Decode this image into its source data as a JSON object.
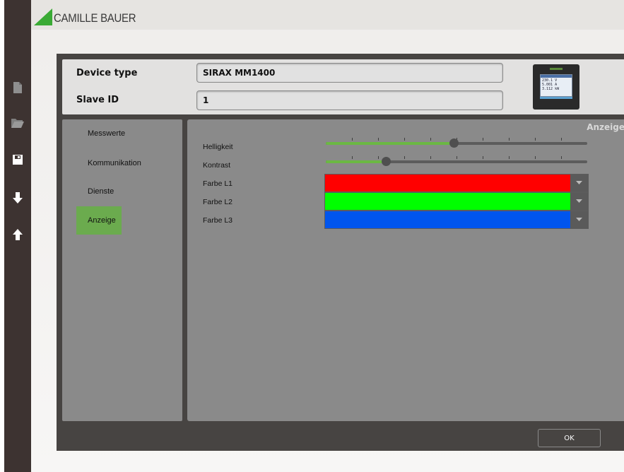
{
  "brand": {
    "logo_text": "CAMILLE BAUER",
    "accent": "#3aaa35"
  },
  "toolbar": {
    "tools": [
      {
        "icon": "new-file-icon"
      },
      {
        "icon": "open-folder-icon"
      },
      {
        "icon": "save-disk-icon"
      },
      {
        "icon": "download-arrow-icon"
      },
      {
        "icon": "upload-arrow-icon"
      }
    ]
  },
  "device": {
    "type_label": "Device type",
    "type_value": "SIRAX MM1400",
    "slave_label": "Slave ID",
    "slave_value": "1",
    "screen": {
      "row1_value": "230.1",
      "row1_unit": "V",
      "row2_value": "5.001",
      "row2_unit": "A",
      "row3_value": "3.112",
      "row3_unit": "kW"
    }
  },
  "nav": {
    "items": [
      {
        "label": "Messwerte",
        "active": false
      },
      {
        "label": "Kommunikation",
        "active": false
      },
      {
        "label": "Dienste",
        "active": false
      },
      {
        "label": "Anzeige",
        "active": true
      }
    ]
  },
  "content": {
    "title": "Anzeige",
    "brightness": {
      "label": "Helligkeit",
      "level_fraction": 0.49
    },
    "contrast": {
      "label": "Kontrast",
      "level_fraction": 0.23
    },
    "color_l1": {
      "label": "Farbe L1",
      "color": "#ff0000"
    },
    "color_l2": {
      "label": "Farbe L2",
      "color": "#00ff00"
    },
    "color_l3": {
      "label": "Farbe L3",
      "color": "#0055ee"
    }
  },
  "footer": {
    "ok_label": "OK"
  },
  "colors": {
    "sidebar_bg": "#3d3331",
    "dialog_bg": "#474442",
    "panel_gray": "#8a8a8a",
    "active_green": "#6bab4e",
    "slider_green": "#6bb843"
  }
}
